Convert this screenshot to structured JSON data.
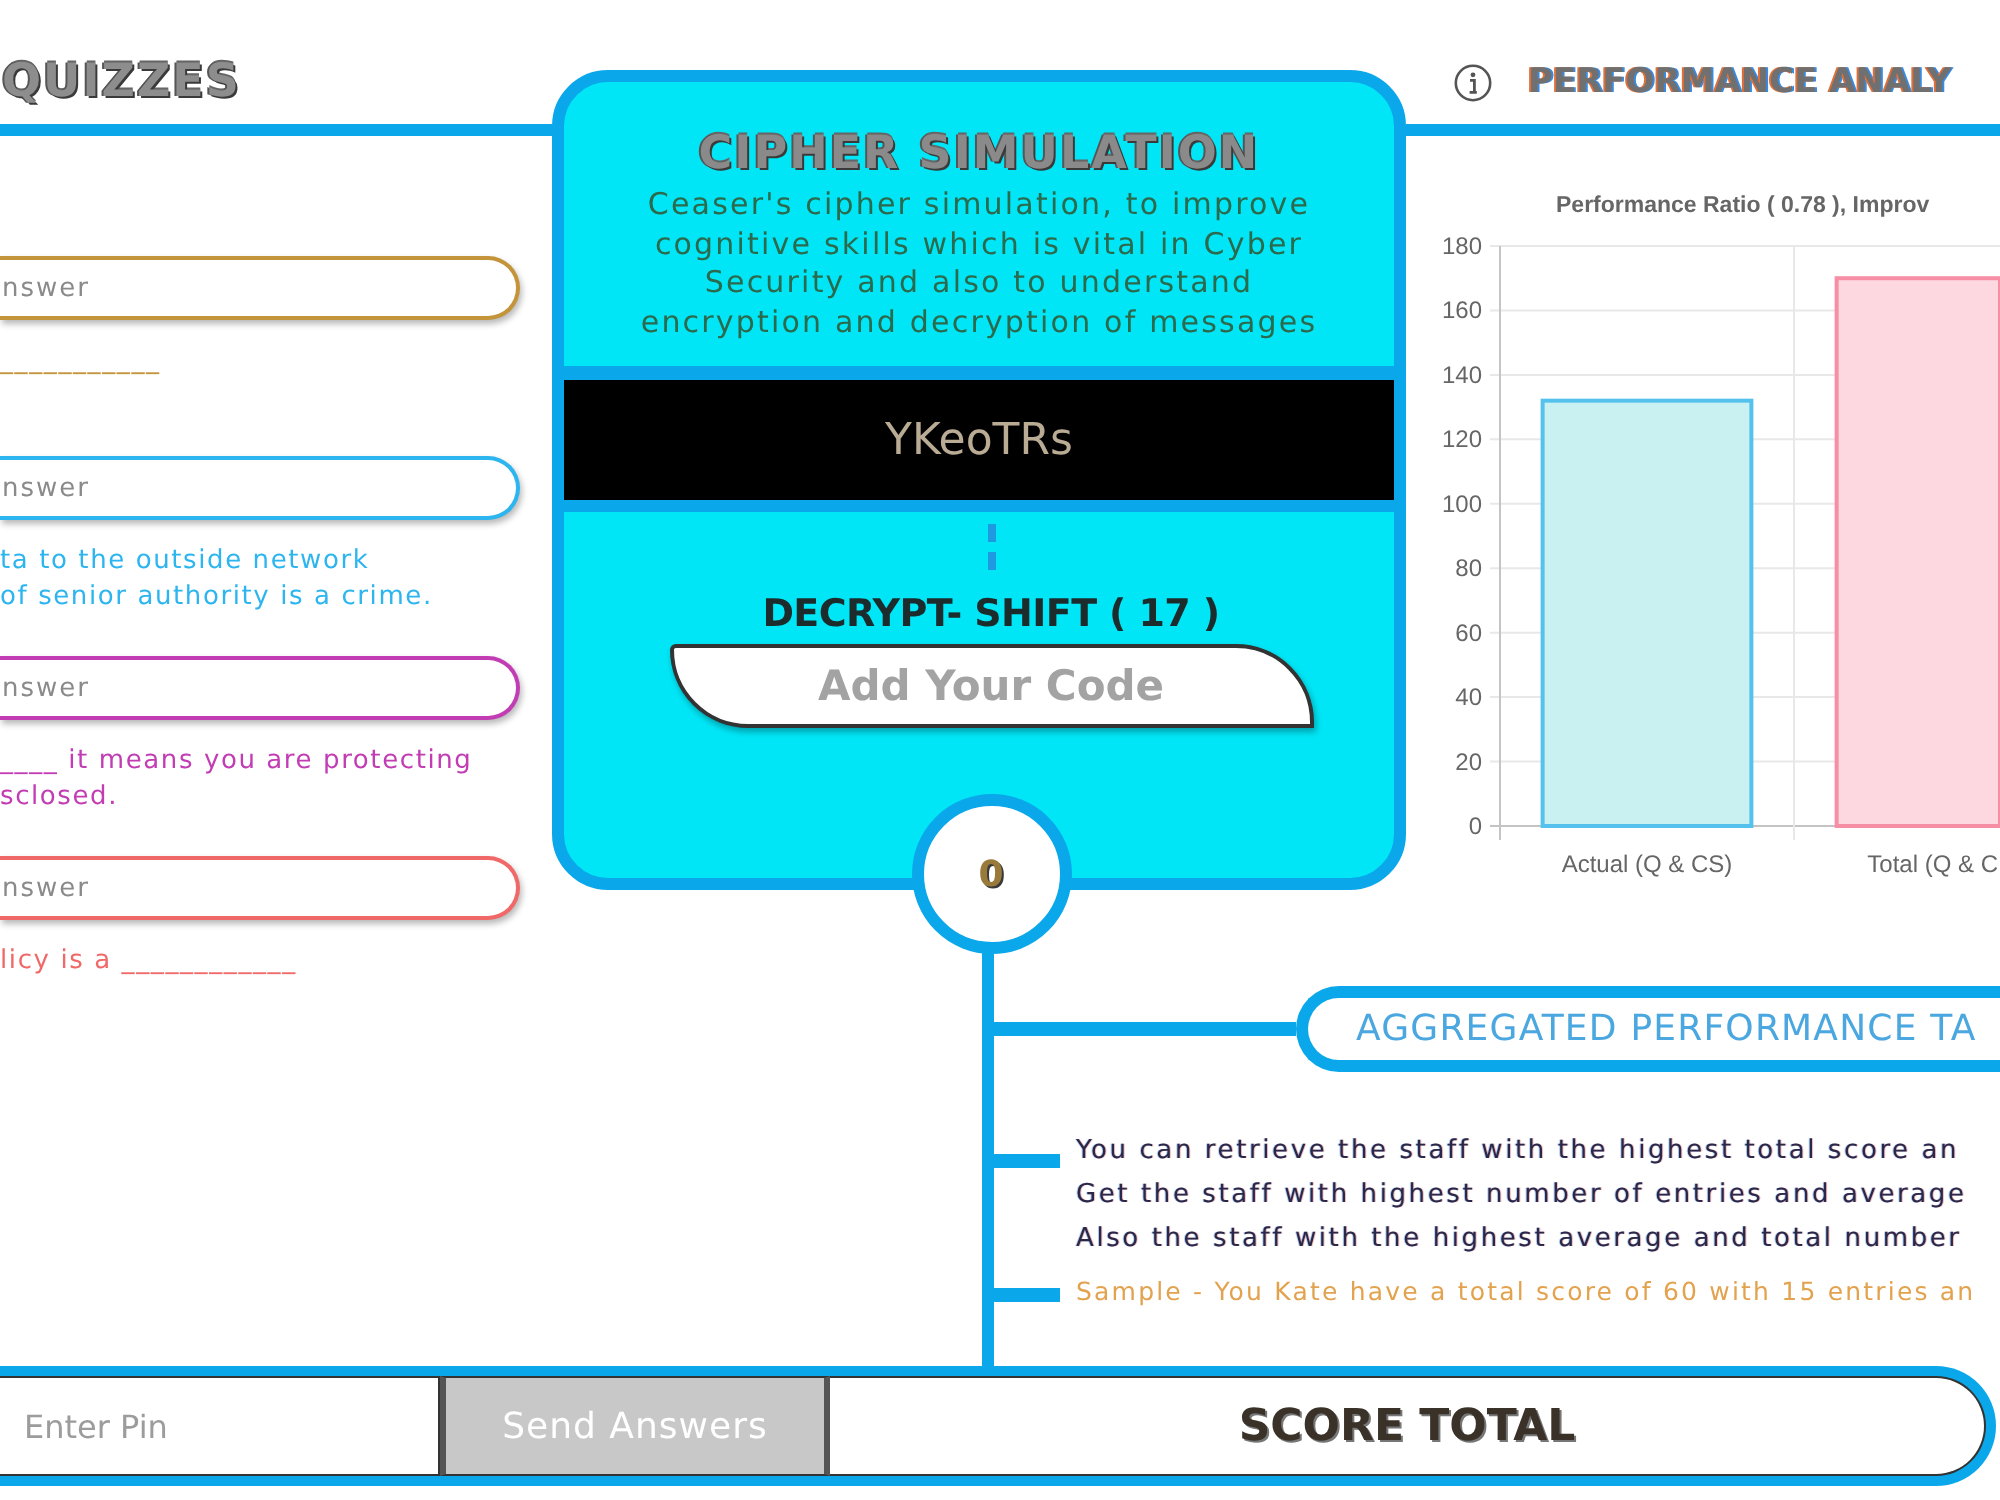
{
  "quizzes": {
    "title": "QUIZZES",
    "items": [
      {
        "placeholder": "nswer",
        "question_lines": [
          "___________"
        ],
        "color": "#c4943a"
      },
      {
        "placeholder": "nswer",
        "question_lines": [
          "ta to the outside network",
          "of senior authority is a crime."
        ],
        "color": "#2cb5ef"
      },
      {
        "placeholder": "nswer",
        "question_lines": [
          "____ it means you are protecting",
          "sclosed."
        ],
        "color": "#c23cb4"
      },
      {
        "placeholder": "nswer",
        "question_lines": [
          "licy is a ____________"
        ],
        "color": "#f06868"
      }
    ]
  },
  "cipher": {
    "title": "CIPHER SIMULATION",
    "description": "Ceaser's cipher simulation, to improve cognitive skills which is vital in Cyber Security and also to understand encryption and decryption of messages",
    "cipher_text": "YKeoTRs",
    "instruction": "DECRYPT- SHIFT ( 17 )",
    "code_field": {
      "placeholder": "Add Your Code"
    },
    "score": "0"
  },
  "performance": {
    "title": "PERFORMANCE ANALY",
    "chart_data": {
      "type": "bar",
      "title": "Performance Ratio ( 0.78 ), Improv",
      "categories": [
        "Actual (Q & CS)",
        "Total (Q & C"
      ],
      "values": [
        132,
        170
      ],
      "ylim": [
        0,
        180
      ],
      "yticks": [
        0,
        20,
        40,
        60,
        80,
        100,
        120,
        140,
        160,
        180
      ],
      "grid": true
    }
  },
  "aggregated": {
    "title": "AGGREGATED PERFORMANCE TA",
    "lines": [
      "You can retrieve the staff with the highest total score an",
      "Get the staff with highest number of entries and average",
      "Also the staff with the highest average and total number"
    ],
    "sample": "Sample - You Kate have a total score of 60 with 15 entries an"
  },
  "footer": {
    "pin_field": {
      "placeholder": "Enter Pin"
    },
    "send_button": "Send Answers",
    "score_label": "SCORE TOTAL"
  }
}
